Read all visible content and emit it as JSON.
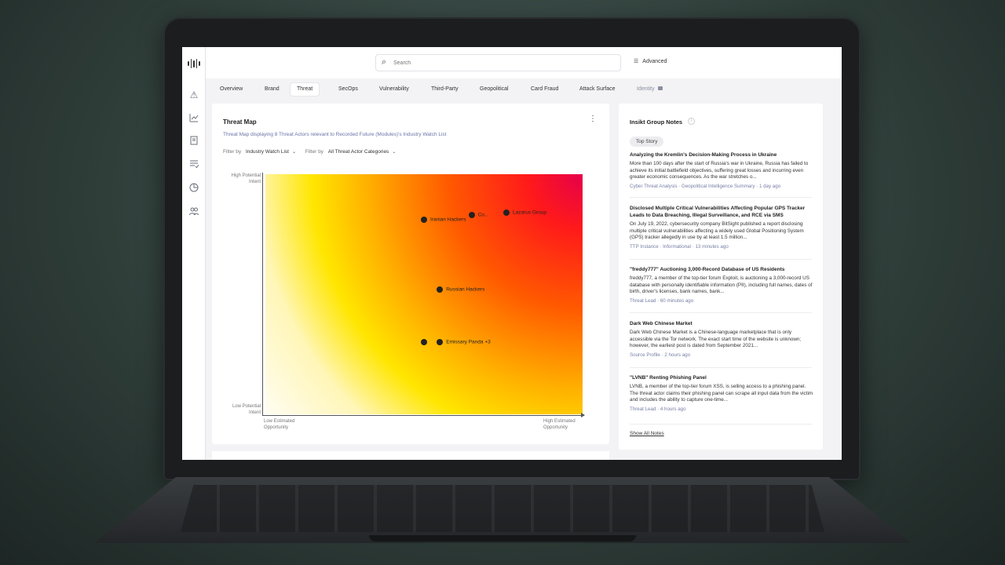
{
  "search": {
    "placeholder": "Search"
  },
  "advanced_label": "Advanced",
  "tabs": [
    {
      "label": "Overview",
      "active": false,
      "locked": false
    },
    {
      "label": "Brand",
      "active": false,
      "locked": false
    },
    {
      "label": "Threat",
      "active": true,
      "locked": false
    },
    {
      "label": "SecOps",
      "active": false,
      "locked": false
    },
    {
      "label": "Vulnerability",
      "active": false,
      "locked": false
    },
    {
      "label": "Third-Party",
      "active": false,
      "locked": false
    },
    {
      "label": "Geopolitical",
      "active": false,
      "locked": false
    },
    {
      "label": "Card Fraud",
      "active": false,
      "locked": false
    },
    {
      "label": "Attack Surface",
      "active": false,
      "locked": false
    },
    {
      "label": "Identity",
      "active": false,
      "locked": true
    }
  ],
  "sidebar_icons": [
    "warning-icon",
    "analytics-icon",
    "document-icon",
    "list-icon",
    "pie-chart-icon",
    "users-icon"
  ],
  "threat_map": {
    "title": "Threat Map",
    "subtitle": "Threat Map displaying 8 Threat Actors relevant to Recorded Future (Modules)'s Industry Watch List",
    "filter_label_1": "Filter by",
    "filter_value_1": "Industry Watch List",
    "filter_label_2": "Filter by",
    "filter_value_2": "All Threat Actor Categories",
    "y_high_line1": "High Potential",
    "y_high_line2": "Intent",
    "y_low_line1": "Low Potential",
    "y_low_line2": "Intent",
    "x_low_line1": "Low Estimated",
    "x_low_line2": "Opportunity",
    "x_high_line1": "High Estimated",
    "x_high_line2": "Opportunity",
    "actors": [
      {
        "label": "Iranian Hackers",
        "opportunity": 0.5,
        "intent": 0.81
      },
      {
        "label": "Co...",
        "opportunity": 0.65,
        "intent": 0.83
      },
      {
        "label": "Lazarus Group",
        "opportunity": 0.76,
        "intent": 0.84
      },
      {
        "label": "Russian Hackers",
        "opportunity": 0.55,
        "intent": 0.52
      },
      {
        "label": "",
        "opportunity": 0.5,
        "intent": 0.3
      },
      {
        "label": "Emissary Panda +3",
        "opportunity": 0.55,
        "intent": 0.3
      }
    ]
  },
  "notes": {
    "title": "Insikt Group Notes",
    "badge": "Top Story",
    "items": [
      {
        "title": "Analyzing the Kremlin's Decision-Making Process in Ukraine",
        "body": "More than 100 days after the start of Russia's war in Ukraine, Russia has failed to achieve its initial battlefield objectives, suffering great losses and incurring even greater economic consequences. As the war stretches o...",
        "meta": "Cyber Threat Analysis · Geopolitical Intelligence Summary · 1 day ago"
      },
      {
        "title": "Disclosed Multiple Critical Vulnerabilities Affecting Popular GPS Tracker Leads to Data Breaching, Illegal Surveillance, and RCE via SMS",
        "body": "On July 19, 2022, cybersecurity company BitSight published a report disclosing multiple critical vulnerabilities affecting a widely used Global Positioning System (GPS) tracker allegedly in use by at least 1.5 million...",
        "meta": "TTP Instance · Informational · 13 minutes ago"
      },
      {
        "title": "\"freddy777\" Auctioning 3,000-Record Database of US Residents",
        "body": "freddy777, a member of the top-tier forum Exploit, is auctioning a 3,000-record US database with personally identifiable information (PII), including full names, dates of birth, driver's licenses, bank names, bank...",
        "meta": "Threat Lead · 60 minutes ago"
      },
      {
        "title": "Dark Web Chinese Market",
        "body": "Dark Web Chinese Market is a Chinese-language marketplace that is only accessible via the Tor network. The exact start time of the website is unknown; however, the earliest post is dated from September 2021...",
        "meta": "Source Profile · 2 hours ago"
      },
      {
        "title": "\"LVNB\" Renting Phishing Panel",
        "body": "LVNB, a member of the top-tier forum XSS, is selling access to a phishing panel. The threat actor claims their phishing panel can scrape all input data from the victim and includes the ability to capture one-time...",
        "meta": "Threat Lead · 4 hours ago"
      }
    ],
    "show_all": "Show All Notes"
  }
}
